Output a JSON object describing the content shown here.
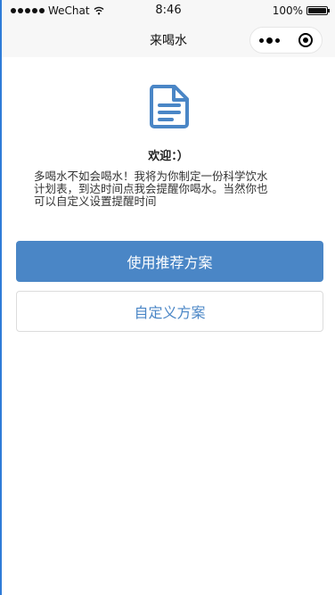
{
  "status_bar": {
    "carrier": "WeChat",
    "time": "8:46",
    "battery": "100%",
    "icons": [
      "signal-dots-icon",
      "wifi-icon",
      "battery-icon"
    ]
  },
  "nav": {
    "title": "来喝水",
    "icons": [
      "more-icon",
      "close-target-icon"
    ]
  },
  "main": {
    "icon": "document-icon",
    "welcome": "欢迎：）",
    "intro": "多喝水不如会喝水！我将为你制定一份科学饮水\n计划表，到达时间点我会提醒你喝水。当然你也\n可以自定义设置提醒时间",
    "primary_button": "使用推荐方案",
    "secondary_button": "自定义方案"
  },
  "colors": {
    "accent": "#4a86c6",
    "nav_bg": "#f7f7f7",
    "left_border": "#2f7cd8"
  }
}
